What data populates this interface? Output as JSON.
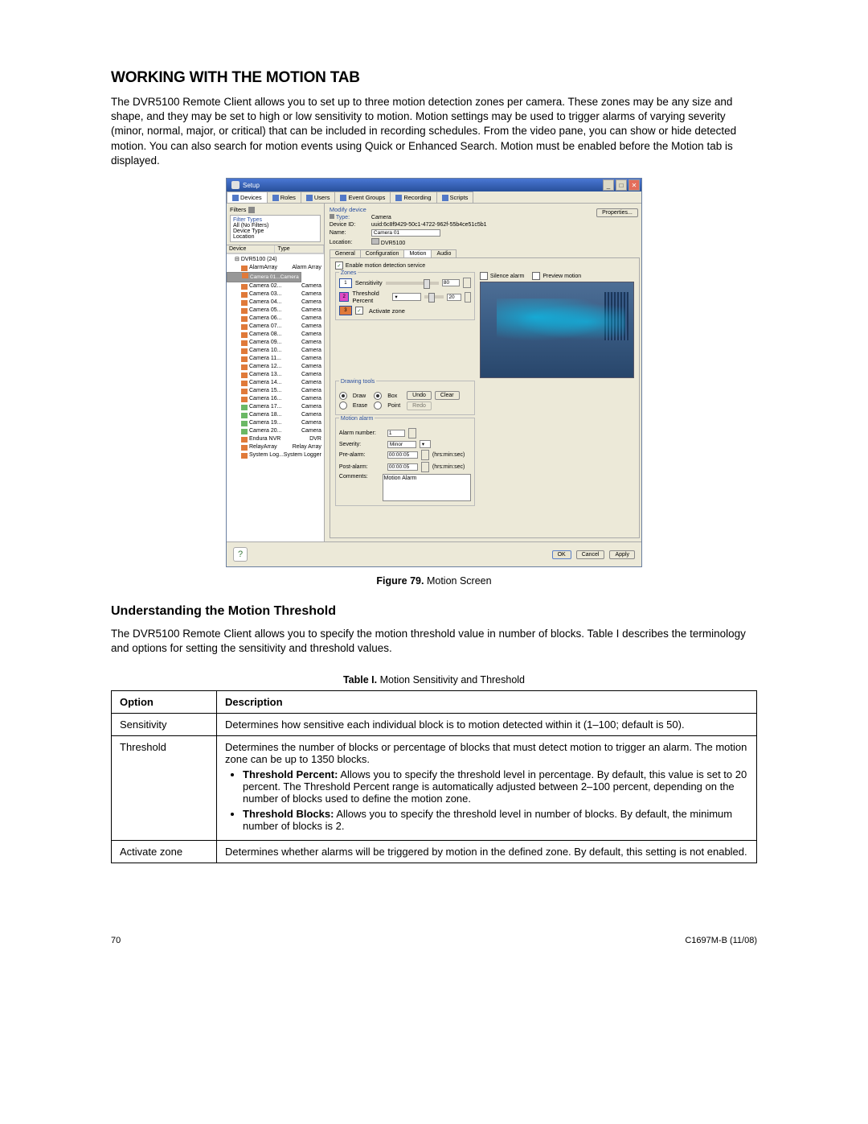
{
  "heading_main": "WORKING WITH THE MOTION TAB",
  "intro_paragraph": "The DVR5100 Remote Client allows you to set up to three motion detection zones per camera. These zones may be any size and shape, and they may be set to high or low sensitivity to motion. Motion settings may be used to trigger alarms of varying severity (minor, normal, major, or critical) that can be included in recording schedules. From the video pane, you can show or hide detected motion. You can also search for motion events using Quick or Enhanced Search. Motion must be enabled before the Motion tab is displayed.",
  "figure_label": "Figure 79.",
  "figure_title": "Motion Screen",
  "subheading": "Understanding the Motion Threshold",
  "sub_paragraph": "The DVR5100 Remote Client allows you to specify the motion threshold value in number of blocks. Table I describes the terminology and options for setting the sensitivity and threshold values.",
  "table_label": "Table I.",
  "table_title": "Motion Sensitivity and Threshold",
  "table": {
    "head_option": "Option",
    "head_desc": "Description",
    "rows": [
      {
        "option": "Sensitivity",
        "desc": "Determines how sensitive each individual block is to motion detected within it (1–100; default is 50)."
      },
      {
        "option": "Threshold",
        "desc": "Determines the number of blocks or percentage of blocks that must detect motion to trigger an alarm. The motion zone can be up to 1350 blocks.",
        "bullets": [
          {
            "b": "Threshold Percent:",
            "t": " Allows you to specify the threshold level in percentage. By default, this value is set to 20 percent. The Threshold Percent range is automatically adjusted between 2–100 percent, depending on the number of blocks used to define the motion zone."
          },
          {
            "b": "Threshold Blocks:",
            "t": " Allows you to specify the threshold level in number of blocks. By default, the minimum number of blocks is 2."
          }
        ]
      },
      {
        "option": "Activate zone",
        "desc": "Determines whether alarms will be triggered by motion in the defined zone. By default, this setting is not enabled."
      }
    ]
  },
  "footer_left": "70",
  "footer_right": "C1697M-B (11/08)",
  "setup": {
    "title": "Setup",
    "tabs": [
      "Devices",
      "Roles",
      "Users",
      "Event Groups",
      "Recording",
      "Scripts"
    ],
    "filters_label": "Filters",
    "filter_types_label": "Filter Types",
    "filter_lines": [
      "All (No Filters)",
      "Device Type",
      "Location"
    ],
    "dev_head": [
      "Device",
      "Type"
    ],
    "tree_root": "DVR5100 (24)",
    "tree": [
      {
        "n": "AlarmArray",
        "t": "Alarm Array",
        "ic": "cam"
      },
      {
        "n": "Camera 01...",
        "t": "Camera",
        "ic": "cam",
        "sel": true
      },
      {
        "n": "Camera 02...",
        "t": "Camera",
        "ic": "cam"
      },
      {
        "n": "Camera 03...",
        "t": "Camera",
        "ic": "cam"
      },
      {
        "n": "Camera 04...",
        "t": "Camera",
        "ic": "cam"
      },
      {
        "n": "Camera 05...",
        "t": "Camera",
        "ic": "cam"
      },
      {
        "n": "Camera 06...",
        "t": "Camera",
        "ic": "cam"
      },
      {
        "n": "Camera 07...",
        "t": "Camera",
        "ic": "cam"
      },
      {
        "n": "Camera 08...",
        "t": "Camera",
        "ic": "cam"
      },
      {
        "n": "Camera 09...",
        "t": "Camera",
        "ic": "cam"
      },
      {
        "n": "Camera 10...",
        "t": "Camera",
        "ic": "cam"
      },
      {
        "n": "Camera 11...",
        "t": "Camera",
        "ic": "cam"
      },
      {
        "n": "Camera 12...",
        "t": "Camera",
        "ic": "cam"
      },
      {
        "n": "Camera 13...",
        "t": "Camera",
        "ic": "cam"
      },
      {
        "n": "Camera 14...",
        "t": "Camera",
        "ic": "cam"
      },
      {
        "n": "Camera 15...",
        "t": "Camera",
        "ic": "cam"
      },
      {
        "n": "Camera 16...",
        "t": "Camera",
        "ic": "cam"
      },
      {
        "n": "Camera 17...",
        "t": "Camera",
        "ic": "camg"
      },
      {
        "n": "Camera 18...",
        "t": "Camera",
        "ic": "camg"
      },
      {
        "n": "Camera 19...",
        "t": "Camera",
        "ic": "camg"
      },
      {
        "n": "Camera 20...",
        "t": "Camera",
        "ic": "camg"
      },
      {
        "n": "Endura NVR",
        "t": "DVR",
        "ic": "cam"
      },
      {
        "n": "RelayArray",
        "t": "Relay Array",
        "ic": "cam"
      },
      {
        "n": "System Log...",
        "t": "System Logger",
        "ic": "cam"
      }
    ],
    "modify_label": "Modify device",
    "type_label": "Type:",
    "type_value": "Camera",
    "deviceid_label": "Device ID:",
    "deviceid_value": "uuid:6c8f9429-50c1-4722-962f-55b4ce51c5b1",
    "name_label": "Name:",
    "name_value": "Camera 01",
    "location_label": "Location:",
    "location_value": "DVR5100",
    "properties_btn": "Properties...",
    "itabs": [
      "General",
      "Configuration",
      "Motion",
      "Audio"
    ],
    "enable_label": "Enable motion detection service",
    "zones_label": "Zones",
    "silence_label": "Silence alarm",
    "preview_label": "Preview motion",
    "sensitivity_label": "Sensitivity",
    "sensitivity_value": "80",
    "threshold_label": "Threshold Percent",
    "threshold_value": "20",
    "activate_label": "Activate zone",
    "zone_nums": [
      "1",
      "2",
      "3"
    ],
    "draw_title": "Drawing tools",
    "tool_draw": "Draw",
    "tool_erase": "Erase",
    "tool_box": "Box",
    "tool_point": "Point",
    "undo": "Undo",
    "clear": "Clear",
    "redo": "Redo",
    "motalarm_title": "Motion alarm",
    "alarm_num_label": "Alarm number:",
    "alarm_num": "1",
    "severity_label": "Severity:",
    "severity": "Minor",
    "prealarm_label": "Pre-alarm:",
    "prealarm": "00:00:05",
    "prealarm_unit": "(hrs:min:sec)",
    "postalarm_label": "Post-alarm:",
    "postalarm": "00:00:05",
    "postalarm_unit": "(hrs:min:sec)",
    "comments_label": "Comments:",
    "comments": "Motion Alarm",
    "ok": "OK",
    "cancel": "Cancel",
    "apply": "Apply"
  }
}
